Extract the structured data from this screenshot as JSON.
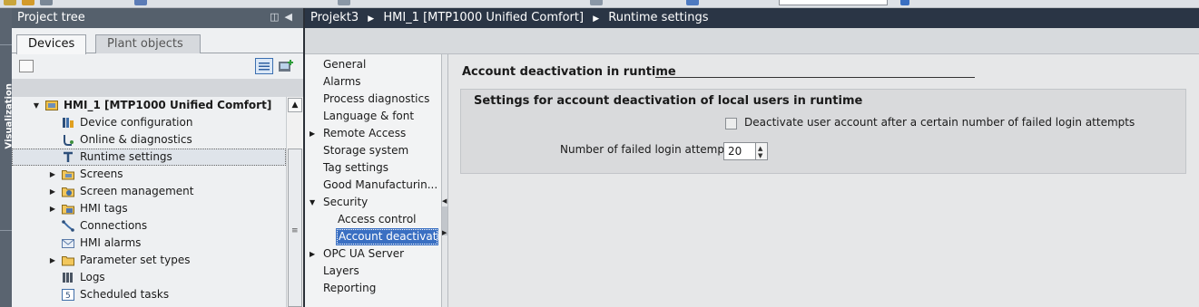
{
  "project_tree": {
    "title": "Project tree",
    "tabs": [
      {
        "label": "Devices",
        "active": true
      },
      {
        "label": "Plant objects",
        "active": false
      }
    ],
    "vertical_tab_label": "Visualization",
    "items": [
      {
        "label": "HMI_1 [MTP1000 Unified Comfort]",
        "icon": "hmi-device-icon"
      },
      {
        "label": "Device configuration",
        "icon": "device-config-icon"
      },
      {
        "label": "Online & diagnostics",
        "icon": "online-diagnostics-icon"
      },
      {
        "label": "Runtime settings",
        "icon": "runtime-settings-icon",
        "selected": true
      },
      {
        "label": "Screens",
        "icon": "screens-folder-icon"
      },
      {
        "label": "Screen management",
        "icon": "screen-management-icon"
      },
      {
        "label": "HMI tags",
        "icon": "hmi-tags-icon"
      },
      {
        "label": "Connections",
        "icon": "connections-icon"
      },
      {
        "label": "HMI alarms",
        "icon": "hmi-alarms-icon"
      },
      {
        "label": "Parameter set types",
        "icon": "folder-icon"
      },
      {
        "label": "Logs",
        "icon": "logs-icon"
      },
      {
        "label": "Scheduled tasks",
        "icon": "scheduled-tasks-icon"
      }
    ]
  },
  "editor": {
    "breadcrumb": [
      "Projekt3",
      "HMI_1 [MTP1000 Unified Comfort]",
      "Runtime settings"
    ],
    "nav": [
      {
        "label": "General"
      },
      {
        "label": "Alarms"
      },
      {
        "label": "Process diagnostics"
      },
      {
        "label": "Language & font"
      },
      {
        "label": "Remote Access",
        "expander": "collapsed"
      },
      {
        "label": "Storage system"
      },
      {
        "label": "Tag settings"
      },
      {
        "label": "Good Manufacturin..."
      },
      {
        "label": "Security",
        "expander": "expanded"
      },
      {
        "label": "Access control",
        "child": true
      },
      {
        "label": "Account deactivati...",
        "child": true,
        "selected": true
      },
      {
        "label": "OPC UA Server",
        "expander": "collapsed"
      },
      {
        "label": "Layers"
      },
      {
        "label": "Reporting"
      }
    ],
    "section_title": "Account deactivation in runtime",
    "group_title": "Settings for account deactivation of local users in runtime",
    "deactivate_checkbox_label": "Deactivate user account after a certain number of failed login attempts",
    "deactivate_checked": false,
    "failed_attempts_label": "Number of failed login attempts:",
    "failed_attempts_value": "20"
  },
  "colors": {
    "panel_header": "#55606c",
    "editor_header": "#2a3545",
    "selection": "#3a6fc2"
  }
}
